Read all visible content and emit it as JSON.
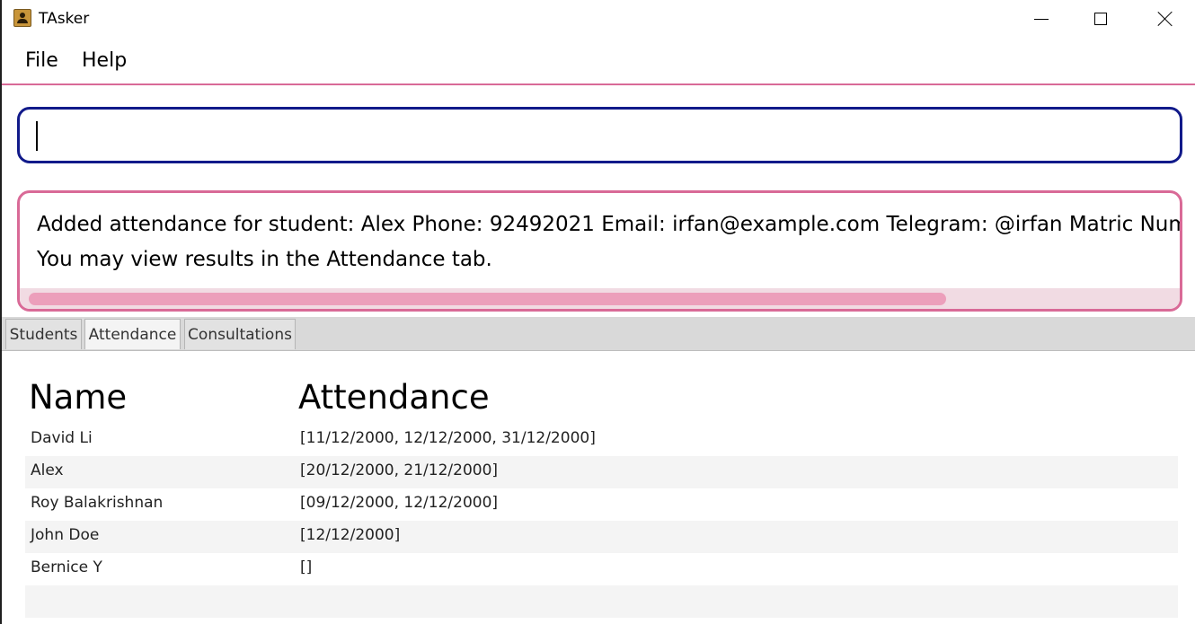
{
  "window": {
    "title": "TAsker",
    "icon": "address-book-icon",
    "controls": [
      "minimize-icon",
      "maximize-icon",
      "close-icon"
    ]
  },
  "menu": {
    "items": [
      {
        "label": "File"
      },
      {
        "label": "Help"
      }
    ]
  },
  "command_box": {
    "value": ""
  },
  "result": {
    "line1": "Added attendance for student: Alex Phone: 92492021 Email: irfan@example.com Telegram: @irfan Matric Numb",
    "line2": "You may view results in the Attendance tab."
  },
  "tabs": [
    {
      "label": "Students",
      "selected": false
    },
    {
      "label": "Attendance",
      "selected": true
    },
    {
      "label": "Consultations",
      "selected": false
    }
  ],
  "table": {
    "headers": {
      "name": "Name",
      "attendance": "Attendance"
    },
    "rows": [
      {
        "name": "David Li",
        "attendance": "[11/12/2000, 12/12/2000, 31/12/2000]"
      },
      {
        "name": "Alex",
        "attendance": "[20/12/2000, 21/12/2000]"
      },
      {
        "name": "Roy Balakrishnan",
        "attendance": "[09/12/2000, 12/12/2000]"
      },
      {
        "name": "John Doe",
        "attendance": "[12/12/2000]"
      },
      {
        "name": "Bernice Y",
        "attendance": "[]"
      },
      {
        "name": "",
        "attendance": ""
      }
    ]
  },
  "colors": {
    "accent_pink": "#d96a97",
    "command_border": "#111a8a",
    "scroll_thumb": "#ec9fbb"
  }
}
